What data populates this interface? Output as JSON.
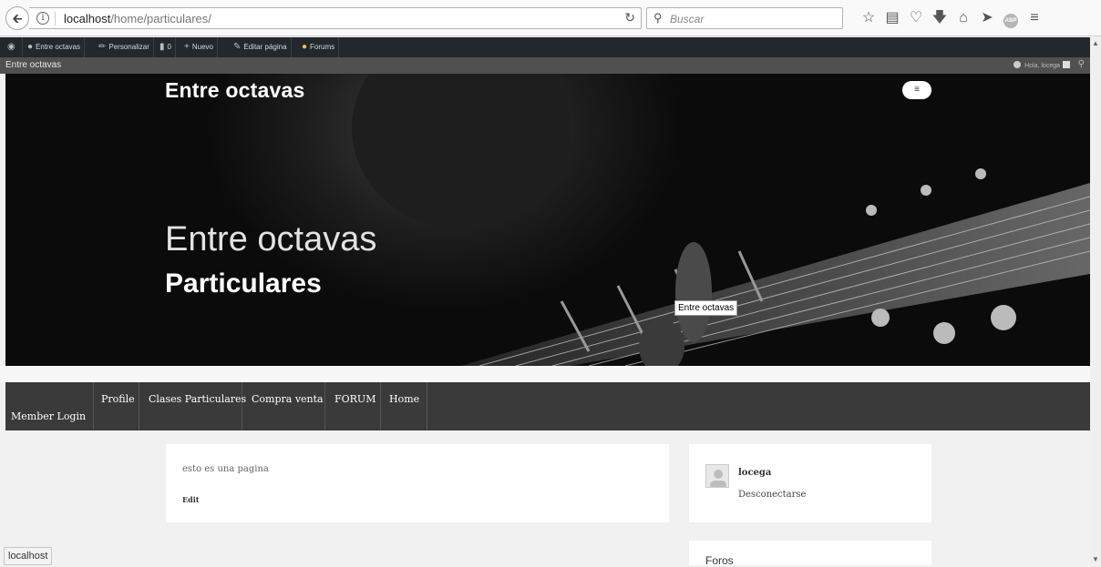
{
  "browser": {
    "url_host": "localhost",
    "url_path": "/home/particulares/",
    "search_placeholder": "Buscar",
    "status_text": "localhost"
  },
  "adminbar": {
    "site": "Entre octavas",
    "customize": "Personalizar",
    "comments_count": "0",
    "new": "Nuevo",
    "edit_page": "Editar página",
    "forums": "Forums",
    "howdy": "Hola, locega"
  },
  "site": {
    "name": "Entre octavas"
  },
  "hero": {
    "title_top": "Entre octavas",
    "title_big": "Entre octavas",
    "subtitle": "Particulares",
    "menu_toggle": "≡",
    "tooltip": "Entre octavas"
  },
  "nav": {
    "items": [
      "Member Login",
      "Profile",
      "Clases Particulares",
      "Compra venta",
      "FORUM",
      "Home"
    ]
  },
  "content": {
    "text": "esto es una pagina",
    "edit": "Edit"
  },
  "sidebar": {
    "username": "locega",
    "logout": "Desconectarse",
    "foros_title": "Foros"
  }
}
